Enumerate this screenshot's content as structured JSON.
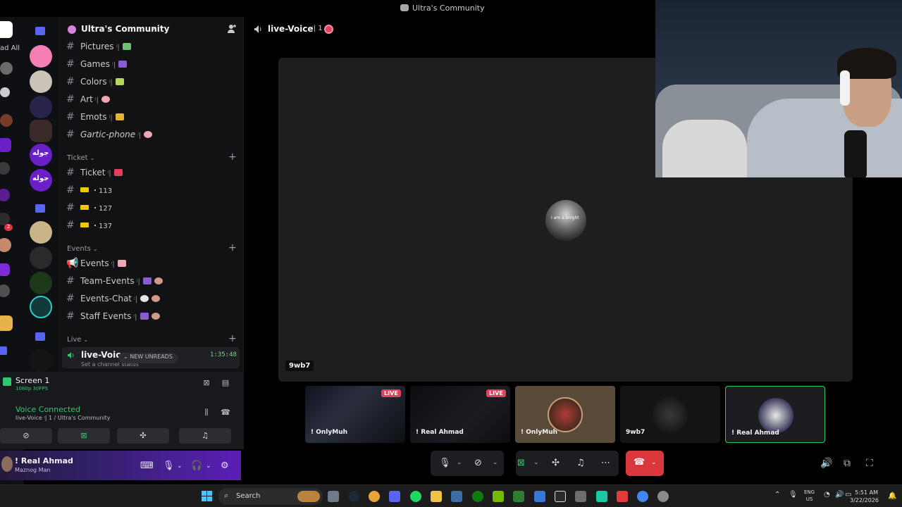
{
  "window": {
    "title": "Ultra's Community"
  },
  "left_rail": {
    "items": [
      "ad All",
      "2"
    ]
  },
  "server_rail": {
    "items": [
      "جوله",
      "جوله"
    ]
  },
  "server": {
    "name": "Ultra's Community",
    "channels_top": [
      {
        "name": "Pictures",
        "suffix": "ᵎ|",
        "emoji_color": "#6fc16f"
      },
      {
        "name": "Games",
        "suffix": "ᵎ|",
        "emoji_color": "#8a5bd6"
      },
      {
        "name": "Colors",
        "suffix": "ᵎ|",
        "emoji_color": "#b5d65b"
      },
      {
        "name": "Art",
        "suffix": "ᵎ|",
        "emoji_color": "#f1a7b3"
      },
      {
        "name": "Emots",
        "suffix": "ᵎ|",
        "emoji_color": "#e4b23a"
      },
      {
        "name": "Gartic-phone",
        "suffix": "ᵎ|",
        "emoji_color": "#f1a7b3"
      }
    ],
    "ticket_category": "Ticket",
    "ticket_channels": [
      {
        "name": "Ticket",
        "suffix": "ᵎ|"
      },
      {
        "name": "・113"
      },
      {
        "name": "・127"
      },
      {
        "name": "・137"
      }
    ],
    "events_category": "Events",
    "events_channels": [
      {
        "name": "Events",
        "suffix": "ᵎ|"
      },
      {
        "name": "Team-Events",
        "suffix": "ᵎ|"
      },
      {
        "name": "Events-Chat",
        "suffix": "ᵎ|"
      },
      {
        "name": "Staff Events",
        "suffix": "ᵎ|"
      }
    ],
    "live_category": "Live",
    "live_voice": {
      "name": "live-Voice",
      "status": "Set a channel status",
      "timer": "1:35:48",
      "new_unreads": "NEW UNREADS"
    }
  },
  "stream_panel": {
    "screen_title": "Screen 1",
    "screen_sub": "1080p 30FPS",
    "voice_connected": "Voice Connected",
    "voice_sub": "live-Voice ᵎ| 1  / Ultra's Community"
  },
  "user_panel": {
    "name": "! Real Ahmad",
    "sub": "Maznog Man"
  },
  "voice_header": {
    "name": "live-Voice",
    "count": "ᵎ| 1"
  },
  "stage": {
    "avatar_text": "I am a knight",
    "label": "9wb7"
  },
  "thumbnails": [
    {
      "label": "! OnlyMuh",
      "live": "LIVE"
    },
    {
      "label": "! Real Ahmad",
      "live": "LIVE"
    },
    {
      "label": "! OnlyMuh"
    },
    {
      "label": "9wb7"
    },
    {
      "label": "! Real Ahmad"
    }
  ],
  "taskbar": {
    "search_placeholder": "Search",
    "lang_1": "ENG",
    "lang_2": "US",
    "time": "5:51 AM",
    "date": "3/22/2026"
  },
  "colors": {
    "accent_green": "#2dc770",
    "live_red": "#e3405c",
    "hangup_red": "#da373c",
    "blurple": "#5865f2"
  }
}
